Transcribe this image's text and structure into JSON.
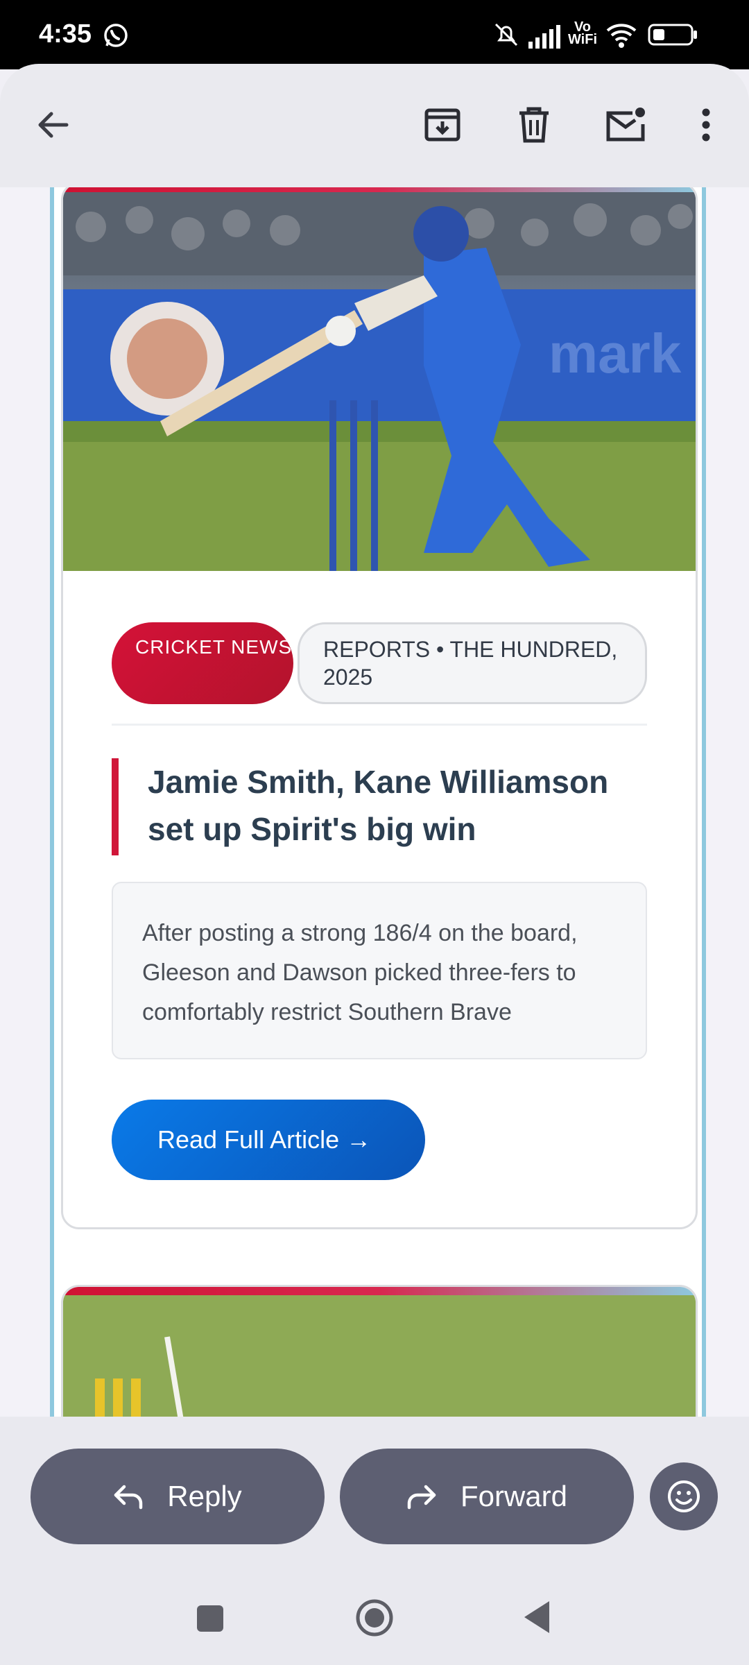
{
  "status_bar": {
    "time": "4:35",
    "network_label": "Vo WiFi",
    "icons": [
      "whatsapp-icon",
      "mute-icon",
      "signal-icon",
      "wifi-icon",
      "battery-icon"
    ]
  },
  "app_bar": {
    "icons": [
      "back-arrow-icon",
      "archive-icon",
      "delete-icon",
      "mark-unread-icon",
      "more-icon"
    ]
  },
  "article": {
    "tag_primary": "CRICKET NEWS",
    "tag_secondary": "REPORTS • THE HUNDRED, 2025",
    "headline": "Jamie Smith, Kane Williamson set up Spirit's big win",
    "summary": "After posting a strong 186/4 on the board, Gleeson and Dawson picked three-fers to comfortably restrict Southern Brave",
    "cta_label": "Read Full Article →"
  },
  "actions": {
    "reply_label": "Reply",
    "forward_label": "Forward",
    "emoji_icon": "emoji-icon"
  },
  "colors": {
    "accent_red": "#d01639",
    "cta_blue": "#0a6fd8",
    "action_pill": "#5d5f72",
    "frame_blue": "#8ec8de"
  }
}
